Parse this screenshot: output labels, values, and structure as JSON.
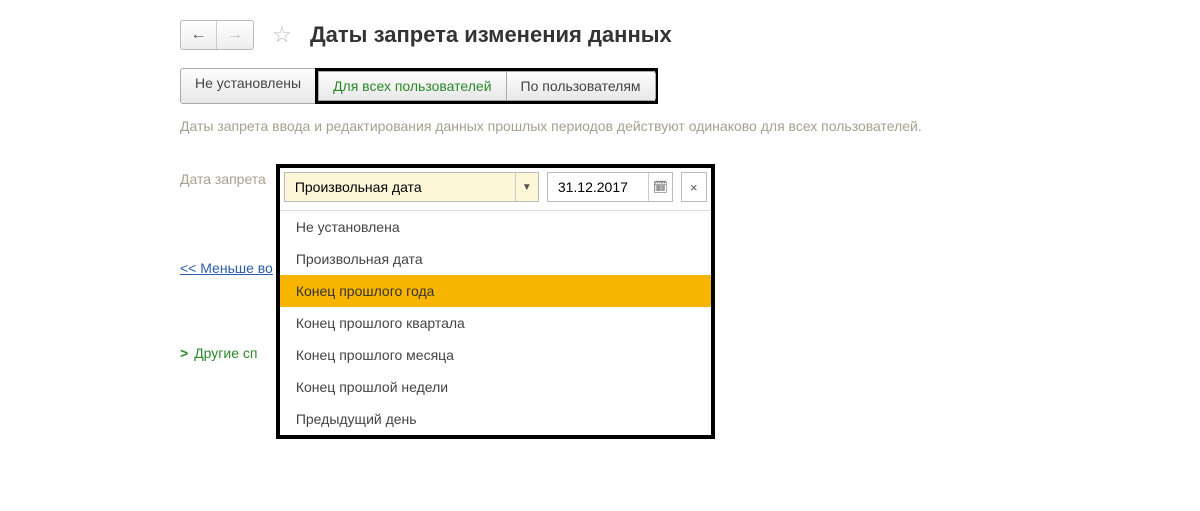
{
  "header": {
    "title": "Даты запрета изменения данных"
  },
  "tabs": [
    {
      "label": "Не установлены",
      "active": false
    },
    {
      "label": "Для всех пользователей",
      "active": true
    },
    {
      "label": "По пользователям",
      "active": false
    }
  ],
  "description": "Даты запрета ввода и редактирования данных прошлых периодов действуют одинаково для всех пользователей.",
  "form": {
    "label": "Дата запрета",
    "select_value": "Произвольная дата",
    "date_value": "31.12.2017"
  },
  "dropdown_items": [
    {
      "label": "Не установлена",
      "highlighted": false
    },
    {
      "label": "Произвольная дата",
      "highlighted": false
    },
    {
      "label": "Конец прошлого года",
      "highlighted": true
    },
    {
      "label": "Конец прошлого квартала",
      "highlighted": false
    },
    {
      "label": "Конец прошлого месяца",
      "highlighted": false
    },
    {
      "label": "Конец прошлой недели",
      "highlighted": false
    },
    {
      "label": "Предыдущий день",
      "highlighted": false
    }
  ],
  "links": {
    "less": "<< Меньше во",
    "other": "Другие сп"
  },
  "icons": {
    "star": "☆",
    "caret": "▼",
    "calendar": "📅",
    "close": "×"
  }
}
